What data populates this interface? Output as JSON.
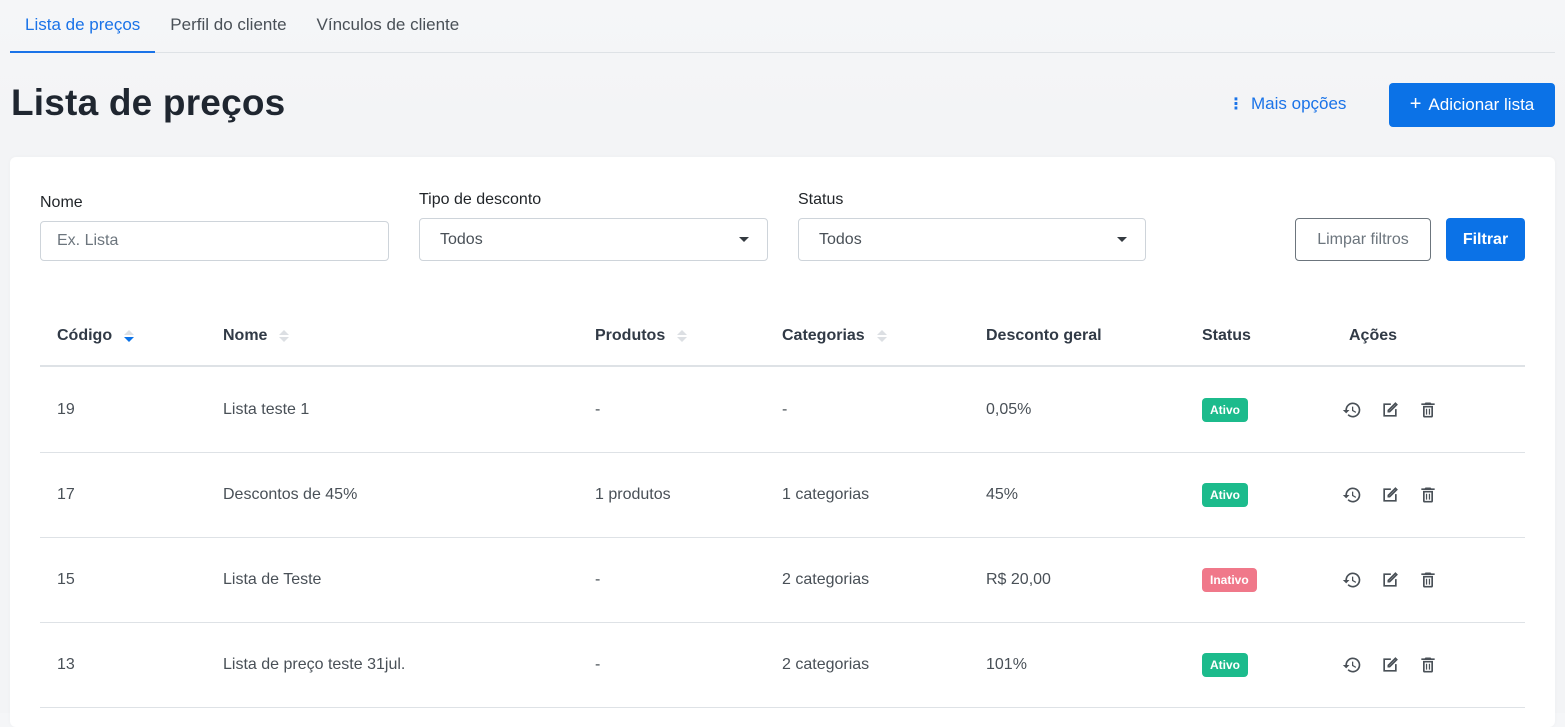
{
  "tabs": [
    {
      "label": "Lista de preços",
      "active": true
    },
    {
      "label": "Perfil do cliente",
      "active": false
    },
    {
      "label": "Vínculos de cliente",
      "active": false
    }
  ],
  "header": {
    "title": "Lista de preços",
    "more_options": "Mais opções",
    "add_button": "Adicionar lista"
  },
  "filters": {
    "name_label": "Nome",
    "name_placeholder": "Ex. Lista",
    "discount_label": "Tipo de desconto",
    "discount_value": "Todos",
    "status_label": "Status",
    "status_value": "Todos",
    "clear_button": "Limpar filtros",
    "filter_button": "Filtrar"
  },
  "table": {
    "columns": [
      "Código",
      "Nome",
      "Produtos",
      "Categorias",
      "Desconto geral",
      "Status",
      "Ações"
    ],
    "sort_column": "Código",
    "rows": [
      {
        "code": "19",
        "name": "Lista teste 1",
        "products": "-",
        "categories": "-",
        "discount": "0,05%",
        "status": "Ativo"
      },
      {
        "code": "17",
        "name": "Descontos de 45%",
        "products": "1 produtos",
        "categories": "1 categorias",
        "discount": "45%",
        "status": "Ativo"
      },
      {
        "code": "15",
        "name": "Lista de Teste",
        "products": "-",
        "categories": "2 categorias",
        "discount": "R$ 20,00",
        "status": "Inativo"
      },
      {
        "code": "13",
        "name": "Lista de preço teste 31jul.",
        "products": "-",
        "categories": "2 categorias",
        "discount": "101%",
        "status": "Ativo"
      }
    ]
  },
  "colors": {
    "accent": "#0b72e7",
    "active_badge": "#1cbb8c",
    "inactive_badge": "#f0788a"
  },
  "icons": {
    "history": "history-icon",
    "edit": "edit-icon",
    "delete": "trash-icon"
  }
}
